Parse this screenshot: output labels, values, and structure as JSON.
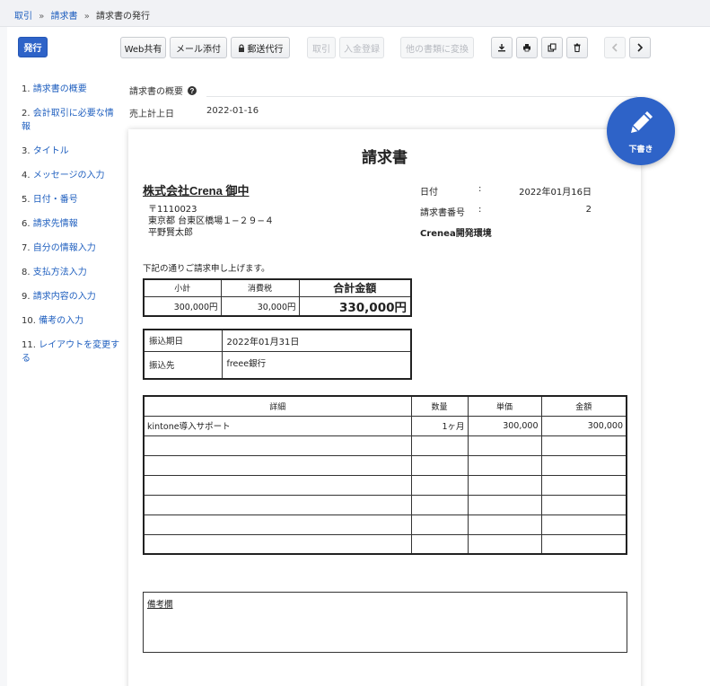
{
  "breadcrumb": {
    "items": [
      "取引",
      "請求書"
    ],
    "current": "請求書の発行",
    "separator": "»"
  },
  "toolbar": {
    "issue_label": "発行",
    "web_share_label": "Web共有",
    "mail_attach_label": "メール添付",
    "postal_label": "郵送代行",
    "cancel_label": "取引",
    "payment_label": "入金登録",
    "convert_label": "他の書類に変換"
  },
  "toc": {
    "items": [
      {
        "num": "1.",
        "label": "請求書の概要"
      },
      {
        "num": "2.",
        "label": "会計取引に必要な情報"
      },
      {
        "num": "3.",
        "label": "タイトル"
      },
      {
        "num": "4.",
        "label": "メッセージの入力"
      },
      {
        "num": "5.",
        "label": "日付・番号"
      },
      {
        "num": "6.",
        "label": "請求先情報"
      },
      {
        "num": "7.",
        "label": "自分の情報入力"
      },
      {
        "num": "8.",
        "label": "支払方法入力"
      },
      {
        "num": "9.",
        "label": "請求内容の入力"
      },
      {
        "num": "10.",
        "label": "備考の入力"
      },
      {
        "num": "11.",
        "label": "レイアウトを変更する"
      }
    ]
  },
  "meta": {
    "overview_label": "請求書の概要",
    "sales_date_label": "売上計上日",
    "sales_date_value": "2022-01-16"
  },
  "fab": {
    "label": "下書き"
  },
  "invoice": {
    "title": "請求書",
    "client_name": "株式会社Crena 御中",
    "postal_code": "〒1110023",
    "address": "東京都 台東区橋場１−２９−４",
    "person": "平野賢太郎",
    "date_label": "日付",
    "date_value": "2022年01月16日",
    "number_label": "請求書番号",
    "number_value": "2",
    "colon": ":",
    "issuer": "Crenea開発環境",
    "message": "下記の通りご請求申し上げます。",
    "summary": {
      "subtotal_label": "小計",
      "tax_label": "消費税",
      "total_label": "合計金額",
      "subtotal_value": "300,000円",
      "tax_value": "30,000円",
      "total_value": "330,000円"
    },
    "payment": {
      "due_label": "振込期日",
      "due_value": "2022年01月31日",
      "bank_label": "振込先",
      "bank_value": "freee銀行"
    },
    "items_table": {
      "headers": [
        "詳細",
        "数量",
        "単価",
        "金額"
      ],
      "rows": [
        [
          "kintone導入サポート",
          "1ヶ月",
          "300,000",
          "300,000"
        ],
        [
          "",
          "",
          "",
          ""
        ],
        [
          "",
          "",
          "",
          ""
        ],
        [
          "",
          "",
          "",
          ""
        ],
        [
          "",
          "",
          "",
          ""
        ],
        [
          "",
          "",
          "",
          ""
        ],
        [
          "",
          "",
          "",
          ""
        ]
      ]
    },
    "remarks_label": "備考欄"
  }
}
